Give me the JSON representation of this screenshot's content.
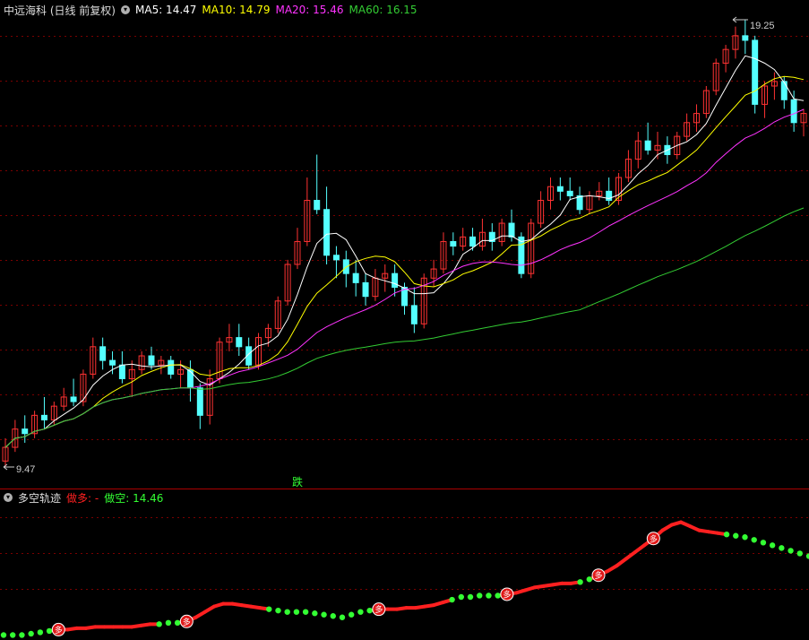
{
  "header": {
    "title": "中远海科 (日线 前复权)",
    "ma5_label": "MA5: 14.47",
    "ma10_label": "MA10: 14.79",
    "ma20_label": "MA20: 15.46",
    "ma60_label": "MA60: 16.15",
    "ma5_color": "#ffffff",
    "ma10_color": "#ffff00",
    "ma20_color": "#ff33ff",
    "ma60_color": "#33cc33"
  },
  "sub_header": {
    "title": "多空轨迹",
    "long_label": "做多: -",
    "short_label": "做空: 14.46",
    "long_color": "#ff2020",
    "short_color": "#33ff33"
  },
  "chart_data": [
    {
      "type": "candlestick",
      "title": "中远海科 (日线 前复权)",
      "max_label": "19.25",
      "min_label": "9.47",
      "signal_label": "跌",
      "up_color": "#ff3232",
      "down_color": "#54ffff",
      "ylim": [
        9.2,
        19.9
      ],
      "max_value": 19.25,
      "min_value": 9.47,
      "candles": [
        [
          9.6,
          10.1,
          9.47,
          9.9
        ],
        [
          9.9,
          10.5,
          9.8,
          10.3
        ],
        [
          10.3,
          10.6,
          10.0,
          10.2
        ],
        [
          10.2,
          10.7,
          10.1,
          10.6
        ],
        [
          10.6,
          11.0,
          10.3,
          10.5
        ],
        [
          10.5,
          10.9,
          10.4,
          10.8
        ],
        [
          10.8,
          11.2,
          10.7,
          11.0
        ],
        [
          11.0,
          11.4,
          10.8,
          10.9
        ],
        [
          10.9,
          11.6,
          10.8,
          11.5
        ],
        [
          11.5,
          12.3,
          11.4,
          12.1
        ],
        [
          12.1,
          12.3,
          11.6,
          11.8
        ],
        [
          11.8,
          12.0,
          11.5,
          11.7
        ],
        [
          11.7,
          12.0,
          11.3,
          11.4
        ],
        [
          11.4,
          11.8,
          11.0,
          11.6
        ],
        [
          11.6,
          12.0,
          11.5,
          11.9
        ],
        [
          11.9,
          12.1,
          11.6,
          11.7
        ],
        [
          11.7,
          11.9,
          11.5,
          11.8
        ],
        [
          11.8,
          11.9,
          11.4,
          11.5
        ],
        [
          11.5,
          11.8,
          11.2,
          11.6
        ],
        [
          11.6,
          11.8,
          10.9,
          11.2
        ],
        [
          11.2,
          11.3,
          10.3,
          10.6
        ],
        [
          10.6,
          11.6,
          10.4,
          11.4
        ],
        [
          11.4,
          12.3,
          11.3,
          12.2
        ],
        [
          12.2,
          12.6,
          12.0,
          12.3
        ],
        [
          12.3,
          12.6,
          11.9,
          12.1
        ],
        [
          12.1,
          12.3,
          11.6,
          11.7
        ],
        [
          11.7,
          12.4,
          11.6,
          12.3
        ],
        [
          12.3,
          12.6,
          12.1,
          12.5
        ],
        [
          12.5,
          13.2,
          12.4,
          13.1
        ],
        [
          13.1,
          14.0,
          13.0,
          13.9
        ],
        [
          13.9,
          14.7,
          13.8,
          14.4
        ],
        [
          14.4,
          15.8,
          14.3,
          15.3
        ],
        [
          15.3,
          16.3,
          15.0,
          15.1
        ],
        [
          15.1,
          15.6,
          13.9,
          14.1
        ],
        [
          14.1,
          14.3,
          13.6,
          14.0
        ],
        [
          14.0,
          14.2,
          13.4,
          13.7
        ],
        [
          13.7,
          14.0,
          13.2,
          13.5
        ],
        [
          13.5,
          13.7,
          13.0,
          13.2
        ],
        [
          13.2,
          13.8,
          13.1,
          13.6
        ],
        [
          13.6,
          13.9,
          13.3,
          13.7
        ],
        [
          13.7,
          13.9,
          13.2,
          13.4
        ],
        [
          13.4,
          13.5,
          12.8,
          13.0
        ],
        [
          13.0,
          13.4,
          12.4,
          12.6
        ],
        [
          12.6,
          13.7,
          12.5,
          13.6
        ],
        [
          13.6,
          14.0,
          13.4,
          13.8
        ],
        [
          13.8,
          14.6,
          13.7,
          14.4
        ],
        [
          14.4,
          14.6,
          14.1,
          14.3
        ],
        [
          14.3,
          14.7,
          14.2,
          14.5
        ],
        [
          14.5,
          14.7,
          14.2,
          14.3
        ],
        [
          14.3,
          14.9,
          14.2,
          14.6
        ],
        [
          14.6,
          14.8,
          14.2,
          14.4
        ],
        [
          14.4,
          14.9,
          14.3,
          14.8
        ],
        [
          14.8,
          15.1,
          14.4,
          14.5
        ],
        [
          14.5,
          14.6,
          13.6,
          13.7
        ],
        [
          13.7,
          14.9,
          13.6,
          14.8
        ],
        [
          14.8,
          15.5,
          14.7,
          15.3
        ],
        [
          15.3,
          15.8,
          15.1,
          15.6
        ],
        [
          15.6,
          15.8,
          15.3,
          15.5
        ],
        [
          15.5,
          15.8,
          15.3,
          15.4
        ],
        [
          15.4,
          15.6,
          15.0,
          15.1
        ],
        [
          15.1,
          15.5,
          15.0,
          15.4
        ],
        [
          15.4,
          15.7,
          15.3,
          15.5
        ],
        [
          15.5,
          15.8,
          15.2,
          15.3
        ],
        [
          15.3,
          15.9,
          15.2,
          15.8
        ],
        [
          15.8,
          16.4,
          15.7,
          16.2
        ],
        [
          16.2,
          16.8,
          16.0,
          16.6
        ],
        [
          16.6,
          17.0,
          16.3,
          16.4
        ],
        [
          16.4,
          16.8,
          16.2,
          16.5
        ],
        [
          16.5,
          16.7,
          16.1,
          16.3
        ],
        [
          16.3,
          16.8,
          16.2,
          16.7
        ],
        [
          16.7,
          17.2,
          16.6,
          17.0
        ],
        [
          17.0,
          17.4,
          16.8,
          17.2
        ],
        [
          17.2,
          17.8,
          17.1,
          17.7
        ],
        [
          17.7,
          18.4,
          17.6,
          18.3
        ],
        [
          18.3,
          18.7,
          18.1,
          18.6
        ],
        [
          18.6,
          19.1,
          18.4,
          18.9
        ],
        [
          18.9,
          19.25,
          18.5,
          18.8
        ],
        [
          18.8,
          18.9,
          17.2,
          17.4
        ],
        [
          17.4,
          17.9,
          17.1,
          17.8
        ],
        [
          17.8,
          18.1,
          17.5,
          17.9
        ],
        [
          17.9,
          18.0,
          17.3,
          17.5
        ],
        [
          17.5,
          17.7,
          16.8,
          17.0
        ],
        [
          17.0,
          17.3,
          16.7,
          17.2
        ]
      ]
    },
    {
      "type": "line",
      "title": "多空轨迹",
      "long_marker_label": "多",
      "values": [
        10.2,
        10.2,
        10.2,
        10.3,
        10.4,
        10.5,
        10.6,
        10.6,
        10.7,
        10.7,
        10.8,
        10.8,
        10.8,
        10.8,
        10.8,
        10.9,
        11.0,
        11.0,
        11.1,
        11.1,
        11.2,
        11.5,
        11.9,
        12.3,
        12.5,
        12.5,
        12.4,
        12.3,
        12.2,
        12.1,
        12.0,
        11.9,
        11.9,
        11.9,
        11.8,
        11.7,
        11.6,
        11.5,
        11.7,
        11.9,
        12.0,
        12.1,
        12.1,
        12.1,
        12.2,
        12.2,
        12.3,
        12.4,
        12.6,
        12.8,
        13.0,
        13.0,
        13.1,
        13.1,
        13.1,
        13.2,
        13.3,
        13.5,
        13.7,
        13.8,
        13.9,
        14.0,
        14.0,
        14.1,
        14.3,
        14.6,
        14.9,
        15.3,
        15.8,
        16.3,
        16.8,
        17.3,
        17.9,
        18.3,
        18.5,
        18.2,
        17.9,
        17.8,
        17.7,
        17.6,
        17.5,
        17.4,
        17.2,
        17.0,
        16.8,
        16.6,
        16.4,
        16.2,
        16.0
      ],
      "state": [
        "s",
        "s",
        "s",
        "s",
        "s",
        "s",
        "l",
        "l",
        "l",
        "l",
        "l",
        "l",
        "l",
        "l",
        "l",
        "l",
        "l",
        "s",
        "s",
        "s",
        "l",
        "l",
        "l",
        "l",
        "l",
        "l",
        "l",
        "l",
        "l",
        "s",
        "s",
        "s",
        "s",
        "s",
        "s",
        "s",
        "s",
        "s",
        "s",
        "s",
        "s",
        "l",
        "l",
        "l",
        "l",
        "l",
        "l",
        "l",
        "l",
        "s",
        "s",
        "s",
        "s",
        "s",
        "s",
        "l",
        "l",
        "l",
        "l",
        "l",
        "l",
        "l",
        "l",
        "s",
        "s",
        "l",
        "l",
        "l",
        "l",
        "l",
        "l",
        "l",
        "l",
        "l",
        "l",
        "l",
        "l",
        "l",
        "l",
        "s",
        "s",
        "s",
        "s",
        "s",
        "s",
        "s",
        "s",
        "s",
        "s"
      ],
      "long_signals": [
        6,
        20,
        41,
        55,
        65,
        71
      ],
      "ylim": [
        10.1,
        18.8
      ]
    }
  ]
}
